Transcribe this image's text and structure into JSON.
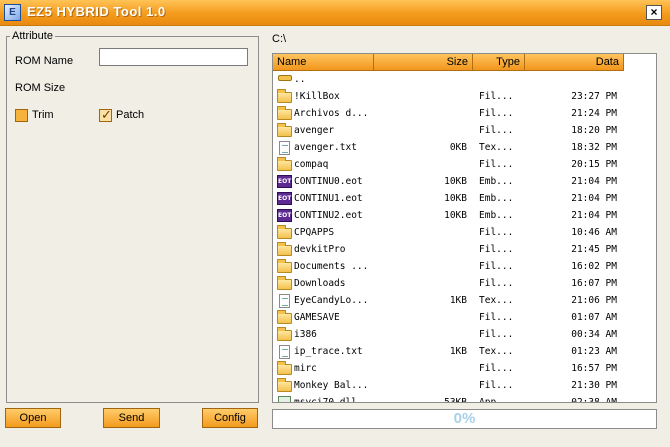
{
  "window": {
    "title": "EZ5 HYBRID Tool 1.0",
    "icon": "app-window-icon",
    "close_icon": "close-icon",
    "close_glyph": "×",
    "accent_color": "#f49b1c"
  },
  "attribute_panel": {
    "legend": "Attribute",
    "rom_name_label": "ROM Name",
    "rom_name_value": "",
    "rom_size_label": "ROM Size",
    "rom_size_value": "",
    "trim_label": "Trim",
    "trim_checked": false,
    "patch_label": "Patch",
    "patch_checked": true
  },
  "buttons": {
    "open": "Open",
    "send": "Send",
    "config": "Config"
  },
  "file_browser": {
    "path": "C:\\",
    "columns": [
      "Name",
      "Size",
      "Type",
      "Data"
    ],
    "rows": [
      {
        "name": "..",
        "size": "",
        "type": "",
        "data": "",
        "icon": "up"
      },
      {
        "name": "!KillBox",
        "size": "",
        "type": "Fil...",
        "data": "23:27 PM",
        "icon": "folder"
      },
      {
        "name": "Archivos d...",
        "size": "",
        "type": "Fil...",
        "data": "21:24 PM",
        "icon": "folder"
      },
      {
        "name": "avenger",
        "size": "",
        "type": "Fil...",
        "data": "18:20 PM",
        "icon": "folder"
      },
      {
        "name": "avenger.txt",
        "size": "0KB",
        "type": "Tex...",
        "data": "18:32 PM",
        "icon": "text"
      },
      {
        "name": "compaq",
        "size": "",
        "type": "Fil...",
        "data": "20:15 PM",
        "icon": "folder"
      },
      {
        "name": "CONTINU0.eot",
        "size": "10KB",
        "type": "Emb...",
        "data": "21:04 PM",
        "icon": "eot"
      },
      {
        "name": "CONTINU1.eot",
        "size": "10KB",
        "type": "Emb...",
        "data": "21:04 PM",
        "icon": "eot"
      },
      {
        "name": "CONTINU2.eot",
        "size": "10KB",
        "type": "Emb...",
        "data": "21:04 PM",
        "icon": "eot"
      },
      {
        "name": "CPQAPPS",
        "size": "",
        "type": "Fil...",
        "data": "10:46 AM",
        "icon": "folder"
      },
      {
        "name": "devkitPro",
        "size": "",
        "type": "Fil...",
        "data": "21:45 PM",
        "icon": "folder"
      },
      {
        "name": "Documents ...",
        "size": "",
        "type": "Fil...",
        "data": "16:02 PM",
        "icon": "folder"
      },
      {
        "name": "Downloads",
        "size": "",
        "type": "Fil...",
        "data": "16:07 PM",
        "icon": "folder"
      },
      {
        "name": "EyeCandyLo...",
        "size": "1KB",
        "type": "Tex...",
        "data": "21:06 PM",
        "icon": "text"
      },
      {
        "name": "GAMESAVE",
        "size": "",
        "type": "Fil...",
        "data": "01:07 AM",
        "icon": "folder"
      },
      {
        "name": "i386",
        "size": "",
        "type": "Fil...",
        "data": "00:34 AM",
        "icon": "folder"
      },
      {
        "name": "ip_trace.txt",
        "size": "1KB",
        "type": "Tex...",
        "data": "01:23 AM",
        "icon": "text"
      },
      {
        "name": "mirc",
        "size": "",
        "type": "Fil...",
        "data": "16:57 PM",
        "icon": "folder"
      },
      {
        "name": "Monkey Bal...",
        "size": "",
        "type": "Fil...",
        "data": "21:30 PM",
        "icon": "folder"
      },
      {
        "name": "msvci70.dll",
        "size": "53KB",
        "type": "App...",
        "data": "02:38 AM",
        "icon": "app"
      }
    ]
  },
  "progress": {
    "value": 0,
    "label": "0%"
  }
}
